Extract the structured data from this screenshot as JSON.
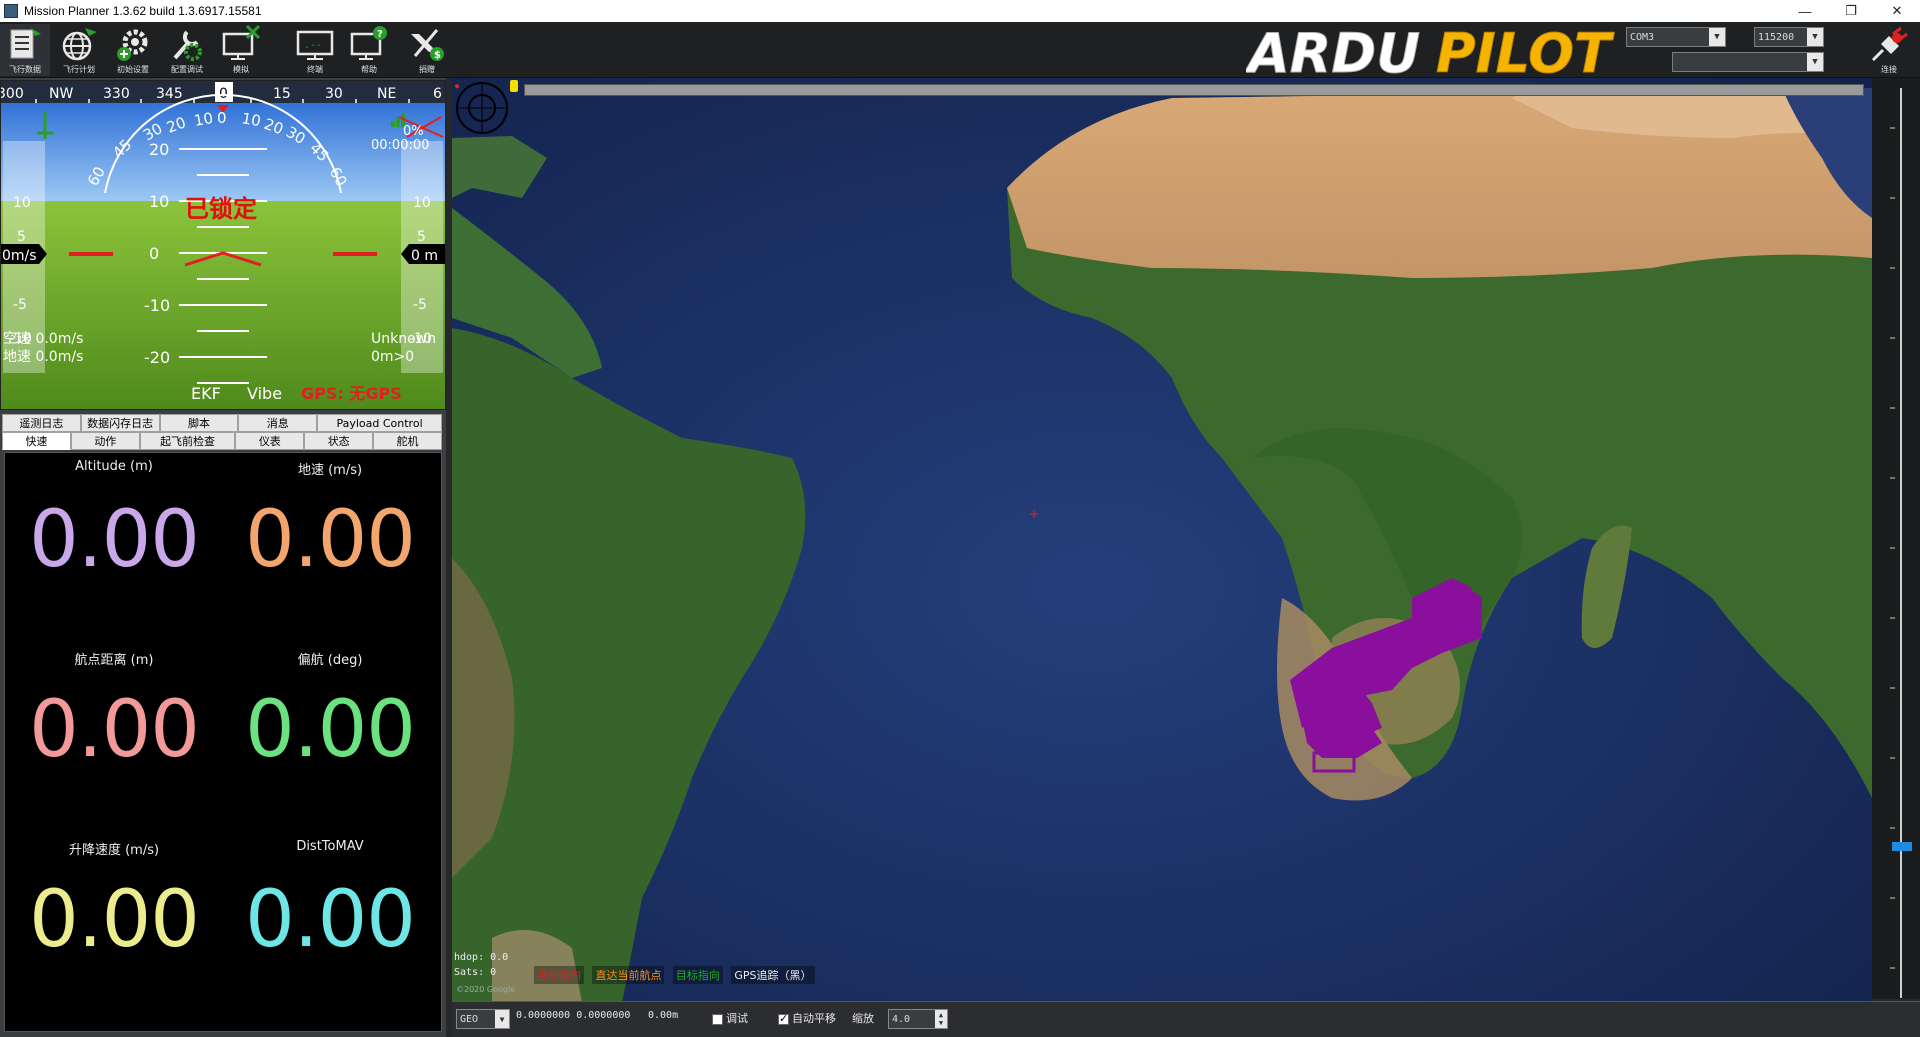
{
  "window": {
    "title": "Mission Planner 1.3.62 build 1.3.6917.15581",
    "controls": [
      "—",
      "❐",
      "✕"
    ]
  },
  "toolbar": {
    "buttons": [
      {
        "label": "飞行数据",
        "icon": "flight-data-icon"
      },
      {
        "label": "飞行计划",
        "icon": "flight-plan-icon"
      },
      {
        "label": "初始设置",
        "icon": "initial-setup-icon"
      },
      {
        "label": "配置调试",
        "icon": "config-tuning-icon"
      },
      {
        "label": "模拟",
        "icon": "simulation-icon"
      },
      {
        "label": "终端",
        "icon": "terminal-icon"
      },
      {
        "label": "帮助",
        "icon": "help-icon"
      },
      {
        "label": "捐赠",
        "icon": "donate-icon"
      }
    ],
    "logo_text_a": "ARDU",
    "logo_text_b": "PILOT",
    "port_select": "COM3",
    "baud_select": "115200",
    "link_select": "",
    "connect_label": "连接"
  },
  "hud": {
    "heading_tape": [
      "300",
      "NW",
      "330",
      "345",
      "0",
      "15",
      "30",
      "NE",
      "6"
    ],
    "heading_current": "0",
    "roll_scale": [
      "60",
      "45",
      "30",
      "20",
      "10",
      "0",
      "10",
      "20",
      "30",
      "45",
      "60"
    ],
    "pitch_labels": [
      "20",
      "10",
      "0",
      "-10",
      "-20"
    ],
    "speed_ticks": [
      "10",
      "5",
      "-5",
      "-10"
    ],
    "alt_ticks": [
      "10",
      "5",
      "-5",
      "-10"
    ],
    "speed_box": "0m/s",
    "alt_box": "0 m",
    "battery_text": "0%",
    "timer": "00:00:00",
    "armed_status": "已锁定",
    "airspeed": "空速 0.0m/s",
    "groundspeed": "地速 0.0m/s",
    "mode": "Unknown",
    "wp_dist": "0m>0",
    "ekf": "EKF",
    "vibe": "Vibe",
    "gps": "GPS: 无GPS",
    "colors": {
      "sky": "#1f6fd8",
      "ground": "#78b42f",
      "armed": "#e01010",
      "gps": "#e02020"
    }
  },
  "tabs": {
    "row1": [
      "遥测日志",
      "数据闪存日志",
      "脚本",
      "消息",
      "Payload Control"
    ],
    "row2": [
      "快速",
      "动作",
      "起飞前检查",
      "仪表",
      "状态",
      "舵机"
    ],
    "active": "快速"
  },
  "quick": [
    {
      "label": "Altitude (m)",
      "value": "0.00",
      "color": "#c9a7e8"
    },
    {
      "label": "地速 (m/s)",
      "value": "0.00",
      "color": "#f2a66e"
    },
    {
      "label": "航点距离 (m)",
      "value": "0.00",
      "color": "#f29a9a"
    },
    {
      "label": "偏航 (deg)",
      "value": "0.00",
      "color": "#6be27f"
    },
    {
      "label": "升降速度 (m/s)",
      "value": "0.00",
      "color": "#ecec8f"
    },
    {
      "label": "DistToMAV",
      "value": "0.00",
      "color": "#6fe6e6"
    }
  ],
  "map": {
    "hdop": "hdop: 0.0",
    "sats": "Sats: 0",
    "legend": [
      {
        "label": "当前指向",
        "color": "#e02020"
      },
      {
        "label": "直达当前航点",
        "color": "#ff8c1a"
      },
      {
        "label": "目标指向",
        "color": "#22aa22"
      },
      {
        "label": "GPS追踪（黑）",
        "color": "#eeeeee"
      }
    ],
    "attribution": "©2020 Google"
  },
  "bottombar": {
    "coord_system": "GEO",
    "coords": "0.0000000 0.0000000",
    "alt": "0.00m",
    "debug_label": "调试",
    "debug_checked": false,
    "autopan_label": "自动平移",
    "autopan_checked": true,
    "zoom_label": "缩放",
    "zoom_value": "4.0"
  }
}
